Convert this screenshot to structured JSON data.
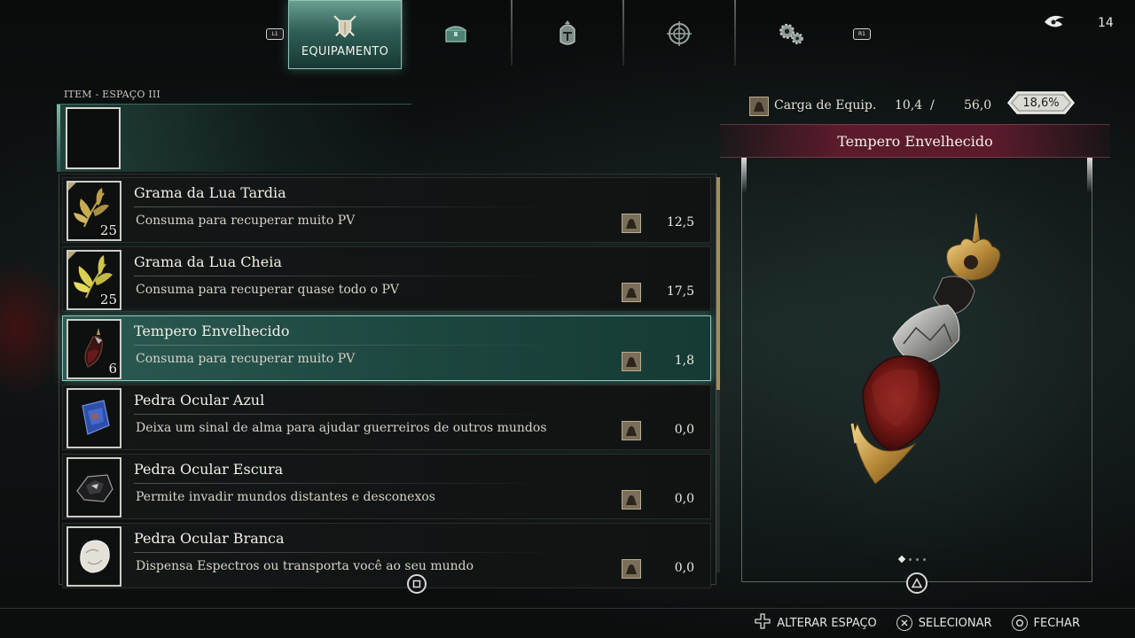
{
  "tabs": {
    "left_shoulder": "L1",
    "right_shoulder": "R1",
    "items": [
      {
        "label": "EQUIPAMENTO",
        "icon": "crossed-swords-shield-icon",
        "active": true
      },
      {
        "label": "",
        "icon": "chest-icon",
        "active": false
      },
      {
        "label": "",
        "icon": "knight-helmet-icon",
        "active": false
      },
      {
        "label": "",
        "icon": "compass-icon",
        "active": false
      },
      {
        "label": "",
        "icon": "gears-icon",
        "active": false
      }
    ]
  },
  "counter": {
    "icon": "soul-icon",
    "value": "14"
  },
  "slot_section": {
    "label": "ITEM - ESPAÇO III"
  },
  "items": [
    {
      "name": "Grama da Lua Tardia",
      "desc": "Consuma para recuperar muito PV",
      "qty": "25",
      "weight": "12,5",
      "icon": "dry-grass-icon",
      "selected": false
    },
    {
      "name": "Grama da Lua Cheia",
      "desc": "Consuma para recuperar quase todo o PV",
      "qty": "25",
      "weight": "17,5",
      "icon": "yellow-grass-icon",
      "selected": false
    },
    {
      "name": "Tempero Envelhecido",
      "desc": "Consuma para recuperar muito PV",
      "qty": "6",
      "weight": "1,8",
      "icon": "spice-flask-icon",
      "selected": true
    },
    {
      "name": "Pedra Ocular Azul",
      "desc": "Deixa um sinal de alma para ajudar guerreiros de outros mundos",
      "qty": "",
      "weight": "0,0",
      "icon": "blue-eye-stone-icon",
      "selected": false
    },
    {
      "name": "Pedra Ocular Escura",
      "desc": "Permite invadir mundos distantes e desconexos",
      "qty": "",
      "weight": "0,0",
      "icon": "dark-eye-stone-icon",
      "selected": false
    },
    {
      "name": "Pedra Ocular Branca",
      "desc": "Dispensa Espectros ou transporta você ao seu mundo",
      "qty": "",
      "weight": "0,0",
      "icon": "white-eye-stone-icon",
      "selected": false
    }
  ],
  "equip_load": {
    "label": "Carga de Equip.",
    "current": "10,4",
    "separator": "/",
    "max": "56,0",
    "percent": "18,6%"
  },
  "detail": {
    "title": "Tempero Envelhecido",
    "image_icon": "aged-spice-flask-icon",
    "page_count": 4,
    "page_current": 1
  },
  "footer": [
    {
      "icon": "dpad-icon",
      "label": "ALTERAR ESPAÇO"
    },
    {
      "icon": "cross-button-icon",
      "label": "SELECIONAR"
    },
    {
      "icon": "circle-button-icon",
      "label": "FECHAR"
    }
  ],
  "colors": {
    "accent_teal": "#2f5f56",
    "detail_header": "#5b1b2c",
    "scroll_thumb": "#a28d5c"
  }
}
